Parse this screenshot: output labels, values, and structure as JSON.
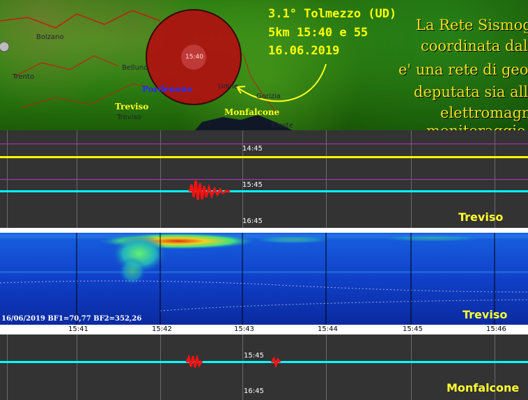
{
  "map": {
    "place_labels": [
      "Bolzano",
      "Belluno",
      "Trento",
      "Pordenone",
      "Udine",
      "Gorizia",
      "Treviso",
      "Trieste"
    ],
    "city_highlight": [
      "Treviso",
      "Monfalcone"
    ],
    "quake_circle_time": "15:40",
    "info_lines": [
      "3.1° Tolmezzo (UD)",
      "5km 15:40 e 55",
      "16.06.2019"
    ],
    "tagline_lines": [
      "La Rete Sismog",
      "coordinata dal",
      "e' una rete di geoar",
      "deputata sia alla",
      "elettromagne",
      "monitoraggio"
    ]
  },
  "panel1": {
    "time_labels": [
      "14:45",
      "15:45",
      "16:45"
    ],
    "station": "Treviso"
  },
  "spectrogram": {
    "status": "16/06/2019 BF1=70,77 BF2=352,26",
    "station": "Treviso",
    "ticks": [
      "15:41",
      "15:42",
      "15:43",
      "15:44",
      "15:45",
      "15:46"
    ]
  },
  "panel2": {
    "time_labels": [
      "15:45",
      "16:45"
    ],
    "station": "Monfalcone"
  },
  "colors": {
    "trace_yellow": "#ffff00",
    "trace_cyan": "#00ffff",
    "event_red": "#ff1010",
    "magenta_line": "#c030c0"
  }
}
